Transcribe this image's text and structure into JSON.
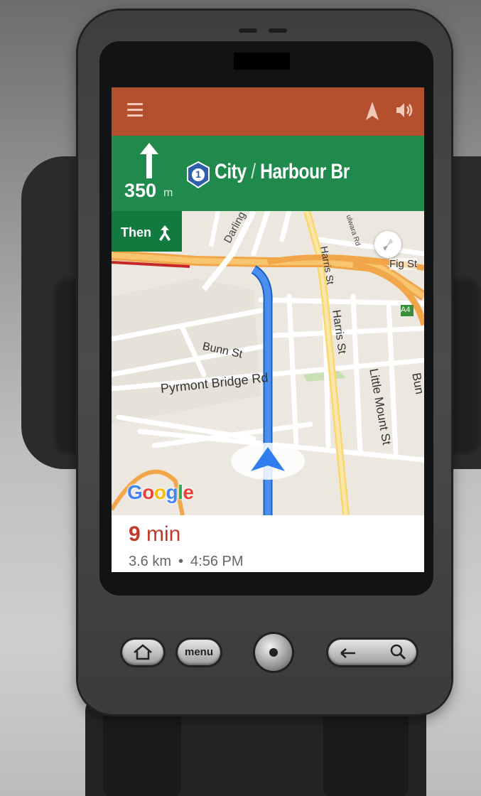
{
  "device": {
    "model": "Android phone in car mount"
  },
  "topbar": {
    "menu_icon": "hamburger-icon",
    "nav_icon": "navigation-arrow-icon",
    "sound_icon": "volume-icon",
    "color": "#b4502e"
  },
  "guidance": {
    "maneuver_icon": "straight-arrow-icon",
    "distance_value": "350",
    "distance_unit": "m",
    "route_shield": "1",
    "street_main": "City",
    "street_separator": "/",
    "street_secondary": "Harbour Br",
    "color": "#1f8a4c"
  },
  "then": {
    "label": "Then",
    "icon": "keep-straight-fork-icon"
  },
  "map": {
    "labels": {
      "darling_dr": "Darling Dr",
      "harris_st_1": "Harris St",
      "harris_st_2": "Harris St",
      "fig_st": "Fig St",
      "bunn_st": "Bunn St",
      "pyrmont_bridge_rd": "Pyrmont Bridge Rd",
      "little_mount_st": "Little Mount St",
      "ullwara_rd": "ulwara Rd",
      "a4": "A4",
      "bun_edge": "Bun"
    },
    "route_color": "#4285f4"
  },
  "google_logo": {
    "letters": [
      "G",
      "o",
      "o",
      "g",
      "l",
      "e"
    ],
    "colors": [
      "#4285f4",
      "#ea4335",
      "#fbbc05",
      "#4285f4",
      "#34a853",
      "#ea4335"
    ]
  },
  "eta": {
    "minutes": "9",
    "minutes_unit": "min",
    "distance": "3.6 km",
    "separator": "•",
    "arrival": "4:56 PM"
  },
  "hardware": {
    "home": "home-icon",
    "menu": "menu",
    "back": "back-arrow-icon",
    "search": "search-icon"
  }
}
